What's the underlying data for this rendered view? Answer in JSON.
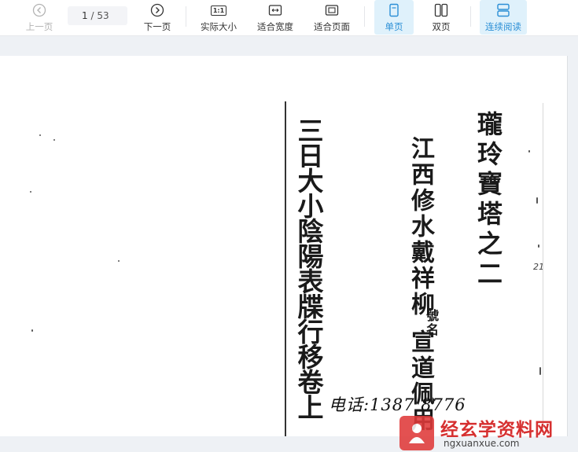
{
  "toolbar": {
    "prev_label": "上一页",
    "page_current": "1",
    "page_total": "/ 53",
    "next_label": "下一页",
    "actual_size_label": "实际大小",
    "actual_size_icon_text": "1:1",
    "fit_width_label": "适合宽度",
    "fit_page_label": "适合页面",
    "single_page_label": "单页",
    "double_page_label": "双页",
    "continuous_label": "连续阅读",
    "accent_color": "#2b8fd6"
  },
  "document": {
    "title_col": "瓏玲寶塔之二",
    "author_col": "江西修水戴祥柳",
    "author_note": "號名",
    "author_cont": "宣道佩用",
    "chapter_col": "三日大小陰陽表牒行移卷上",
    "margin_mark": "21",
    "phone": "电话:1387 8776"
  },
  "watermark": {
    "site_name": "经玄学资料网",
    "url": "ngxuanxue.com",
    "color": "#d63030"
  }
}
